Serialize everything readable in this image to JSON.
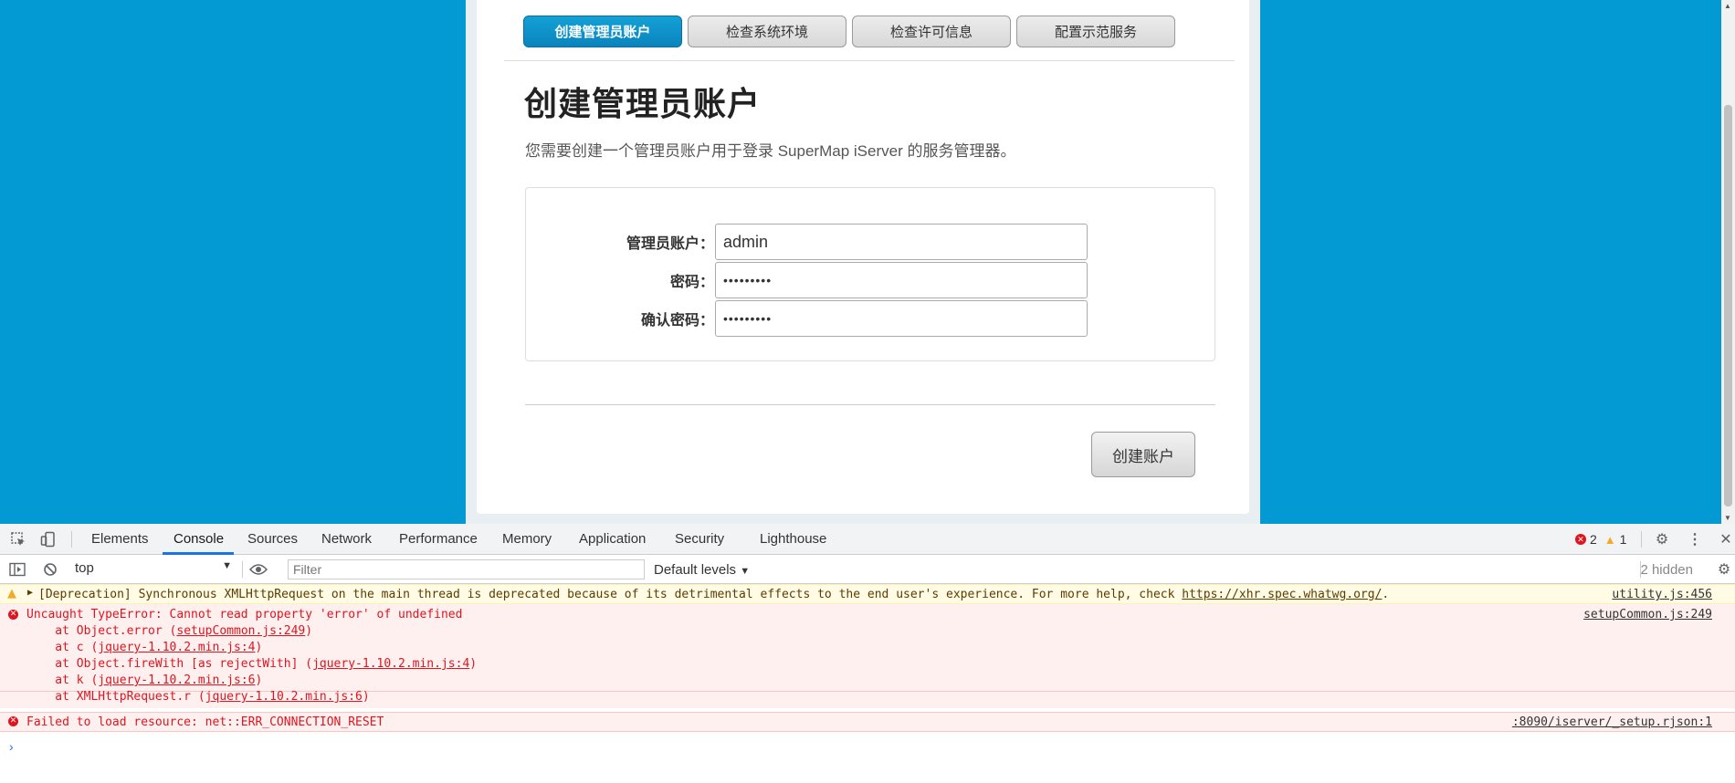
{
  "wizard": {
    "steps": [
      "创建管理员账户",
      "检查系统环境",
      "检查许可信息",
      "配置示范服务"
    ],
    "active_step": 0,
    "title": "创建管理员账户",
    "description": "您需要创建一个管理员账户用于登录 SuperMap iServer 的服务管理器。",
    "fields": {
      "account_label": "管理员账户：",
      "account_value": "admin",
      "password_label": "密码：",
      "password_value": "•••••••••",
      "confirm_label": "确认密码：",
      "confirm_value": "•••••••••"
    },
    "create_button": "创建账户"
  },
  "devtools": {
    "tabs": [
      "Elements",
      "Console",
      "Sources",
      "Network",
      "Performance",
      "Memory",
      "Application",
      "Security",
      "Lighthouse"
    ],
    "active_tab": "Console",
    "error_count": "2",
    "warning_count": "1",
    "context": "top",
    "filter_placeholder": "Filter",
    "levels": "Default levels",
    "hidden": "2 hidden",
    "messages": {
      "warn": {
        "text_before": "[Deprecation] Synchronous XMLHttpRequest on the main thread is deprecated because of its detrimental effects to the end user's experience. For more help, check ",
        "link": "https://xhr.spec.whatwg.org/",
        "text_after": ".",
        "source": "utility.js:456"
      },
      "error1": {
        "text": "Uncaught TypeError: Cannot read property 'error' of undefined",
        "source": "setupCommon.js:249",
        "stack": [
          {
            "prefix": "    at Object.error (",
            "link": "setupCommon.js:249",
            "suffix": ")"
          },
          {
            "prefix": "    at c (",
            "link": "jquery-1.10.2.min.js:4",
            "suffix": ")"
          },
          {
            "prefix": "    at Object.fireWith [as rejectWith] (",
            "link": "jquery-1.10.2.min.js:4",
            "suffix": ")"
          },
          {
            "prefix": "    at k (",
            "link": "jquery-1.10.2.min.js:6",
            "suffix": ")"
          },
          {
            "prefix": "    at XMLHttpRequest.r (",
            "link": "jquery-1.10.2.min.js:6",
            "suffix": ")"
          }
        ]
      },
      "error2": {
        "text": "Failed to load resource: net::ERR_CONNECTION_RESET",
        "source": ":8090/iserver/_setup.rjson:1"
      }
    },
    "prompt": "›"
  }
}
